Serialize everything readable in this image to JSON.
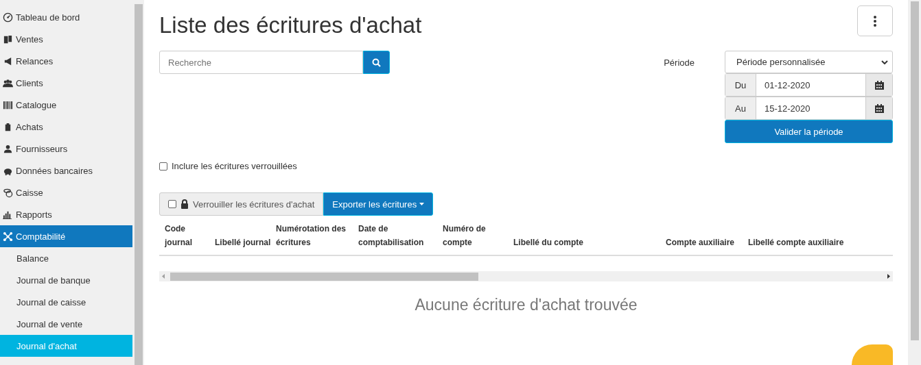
{
  "sidebar": {
    "items": [
      {
        "label": "Tableau de bord",
        "kind": "main",
        "selected": false
      },
      {
        "label": "Ventes",
        "kind": "main",
        "selected": false
      },
      {
        "label": "Relances",
        "kind": "main",
        "selected": false
      },
      {
        "label": "Clients",
        "kind": "main",
        "selected": false
      },
      {
        "label": "Catalogue",
        "kind": "main",
        "selected": false
      },
      {
        "label": "Achats",
        "kind": "main",
        "selected": false
      },
      {
        "label": "Fournisseurs",
        "kind": "main",
        "selected": false
      },
      {
        "label": "Données bancaires",
        "kind": "main",
        "selected": false
      },
      {
        "label": "Caisse",
        "kind": "main",
        "selected": false
      },
      {
        "label": "Rapports",
        "kind": "main",
        "selected": false
      },
      {
        "label": "Comptabilité",
        "kind": "main",
        "selected": true
      },
      {
        "label": "Balance",
        "kind": "sub",
        "selected": false
      },
      {
        "label": "Journal de banque",
        "kind": "sub",
        "selected": false
      },
      {
        "label": "Journal de caisse",
        "kind": "sub",
        "selected": false
      },
      {
        "label": "Journal de vente",
        "kind": "sub",
        "selected": false
      },
      {
        "label": "Journal d'achat",
        "kind": "sub",
        "selected": true
      }
    ]
  },
  "title": "Liste des écritures d'achat",
  "search": {
    "placeholder": "Recherche"
  },
  "period": {
    "label": "Période",
    "select": "Période personnalisée",
    "from_label": "Du",
    "from": "01-12-2020",
    "to_label": "Au",
    "to": "15-12-2020",
    "validate": "Valider la période"
  },
  "include_locked": {
    "label": "Inclure les écritures verrouillées",
    "checked": false
  },
  "lock": {
    "label": "Verrouiller les écritures d'achat",
    "checked": false
  },
  "export_button": "Exporter les écritures",
  "table": {
    "columns": [
      "Code journal",
      "Libellé journal",
      "Numérotation des écritures",
      "Date de comptabilisation",
      "Numéro de compte",
      "Libellé du compte",
      "Compte auxiliaire",
      "Libellé compte auxiliaire"
    ]
  },
  "empty_message": "Aucune écriture d'achat trouvée"
}
